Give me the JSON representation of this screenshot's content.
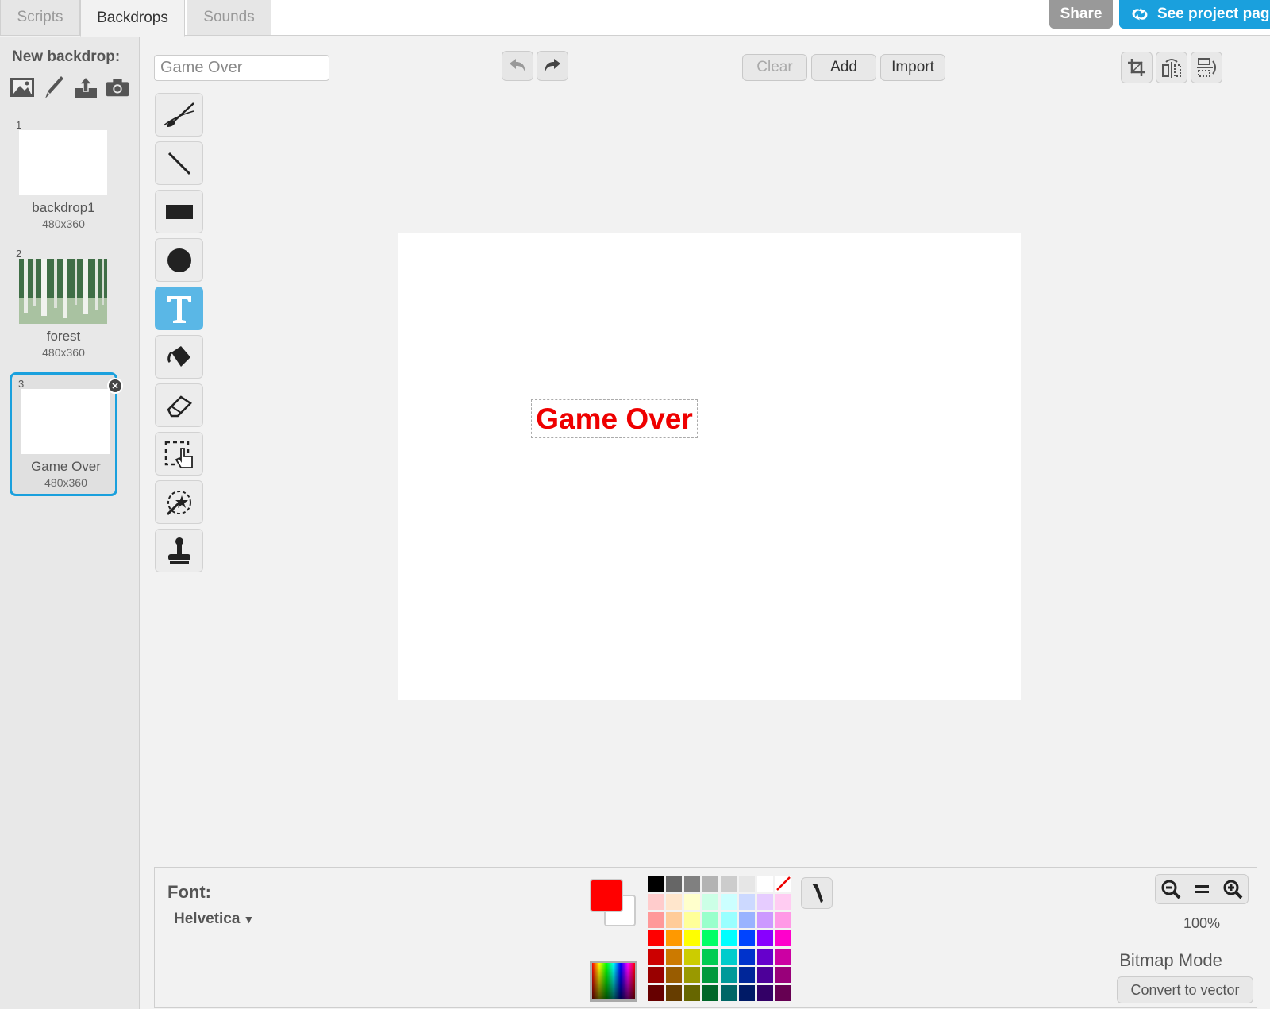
{
  "tabs": [
    {
      "label": "Scripts"
    },
    {
      "label": "Backdrops"
    },
    {
      "label": "Sounds"
    }
  ],
  "header": {
    "share_label": "Share",
    "project_label": "See project page"
  },
  "sidebar": {
    "new_backdrop_label": "New backdrop:",
    "backdrops": [
      {
        "number": "1",
        "name": "backdrop1",
        "size": "480x360"
      },
      {
        "number": "2",
        "name": "forest",
        "size": "480x360"
      },
      {
        "number": "3",
        "name": "Game Over",
        "size": "480x360",
        "selected": true
      }
    ]
  },
  "editor": {
    "name_value": "Game Over",
    "clear_label": "Clear",
    "add_label": "Add",
    "import_label": "Import",
    "canvas_text": "Game Over",
    "canvas_text_color": "#ee0000",
    "active_tool": "text"
  },
  "bottom": {
    "font_label": "Font:",
    "font_value": "Helvetica",
    "zoom": "100%",
    "mode_label": "Bitmap Mode",
    "convert_label": "Convert to vector",
    "primary_color": "#ff0000",
    "secondary_color": "#ffffff",
    "palette": [
      "#000000",
      "#666666",
      "#808080",
      "#b3b3b3",
      "#cccccc",
      "#e6e6e6",
      "#ffffff",
      "transparent",
      "#ffcccc",
      "#ffe6cc",
      "#ffffcc",
      "#ccffe6",
      "#ccffff",
      "#ccd9ff",
      "#e6ccff",
      "#ffccf2",
      "#ff9999",
      "#ffcc99",
      "#ffff99",
      "#99ffcc",
      "#99ffff",
      "#99b3ff",
      "#cc99ff",
      "#ff99e6",
      "#ff0000",
      "#ff9900",
      "#ffff00",
      "#00ff66",
      "#00ffff",
      "#0044ff",
      "#8800ff",
      "#ff00cc",
      "#cc0000",
      "#cc7a00",
      "#cccc00",
      "#00cc52",
      "#00cccc",
      "#0033cc",
      "#6600cc",
      "#cc00a3",
      "#990000",
      "#995c00",
      "#999900",
      "#00993d",
      "#009999",
      "#002699",
      "#4d0099",
      "#99007a",
      "#660000",
      "#663d00",
      "#666600",
      "#006629",
      "#006666",
      "#001a66",
      "#330066",
      "#660052"
    ]
  }
}
